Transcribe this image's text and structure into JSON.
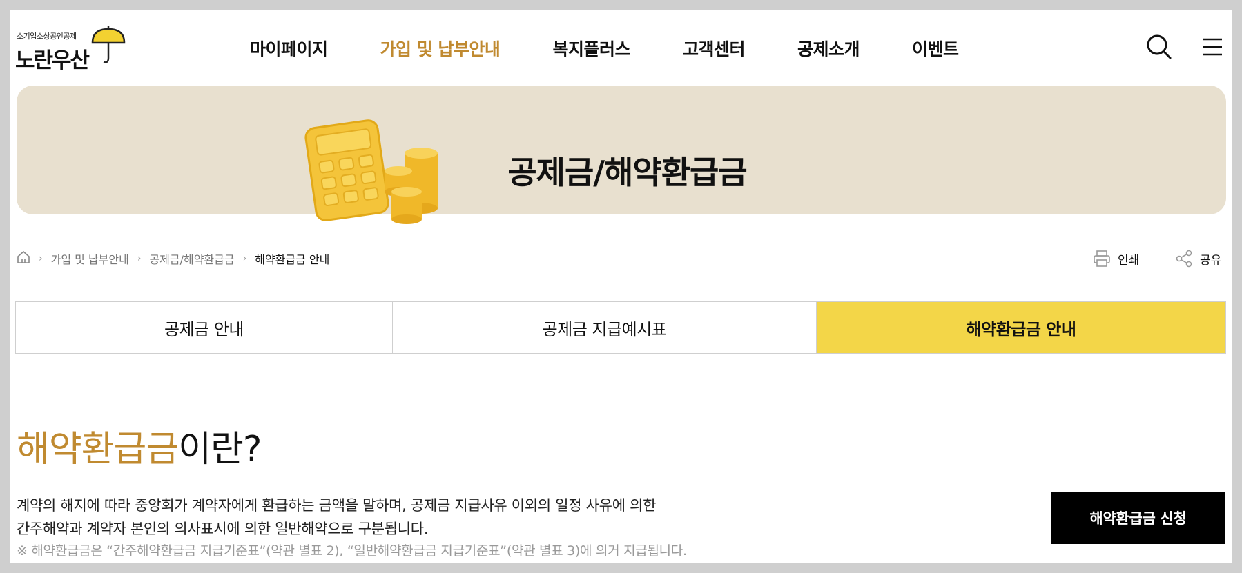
{
  "header": {
    "logo_small": "소기업소상공인공제",
    "logo_big": "노란우산",
    "nav": [
      {
        "label": "마이페이지",
        "active": false
      },
      {
        "label": "가입 및 납부안내",
        "active": true
      },
      {
        "label": "복지플러스",
        "active": false
      },
      {
        "label": "고객센터",
        "active": false
      },
      {
        "label": "공제소개",
        "active": false
      },
      {
        "label": "이벤트",
        "active": false
      }
    ],
    "icons": {
      "search": "search-icon",
      "menu": "hamburger-menu-icon"
    }
  },
  "banner": {
    "title": "공제금/해약환급금",
    "art": "calculator-coins-illustration"
  },
  "breadcrumb": {
    "home_icon": "home-icon",
    "items": [
      "가입 및 납부안내",
      "공제금/해약환급금",
      "해약환급금 안내"
    ]
  },
  "utilities": {
    "print_label": "인쇄",
    "share_label": "공유"
  },
  "tabs": [
    {
      "label": "공제금 안내",
      "active": false
    },
    {
      "label": "공제금 지급예시표",
      "active": false
    },
    {
      "label": "해약환급금 안내",
      "active": true
    }
  ],
  "content": {
    "heading_accent": "해약환급금",
    "heading_rest": "이란?",
    "desc_line1": "계약의 해지에 따라 중앙회가 계약자에게 환급하는 금액을 말하며, 공제금 지급사유 이외의 일정 사유에 의한",
    "desc_line2": "간주해약과 계약자 본인의 의사표시에 의한 일반해약으로 구분됩니다.",
    "note": "※ 해약환급금은 “간주해약환급금 지급기준표”(약관 별표 2), “일반해약환급금 지급기준표”(약관 별표 3)에 의거 지급됩니다.",
    "apply_button": "해약환급금 신청"
  },
  "colors": {
    "accent": "#c08a30",
    "tab_active": "#f3d648",
    "banner_bg": "#e8e0cf",
    "button_bg": "#000000"
  }
}
